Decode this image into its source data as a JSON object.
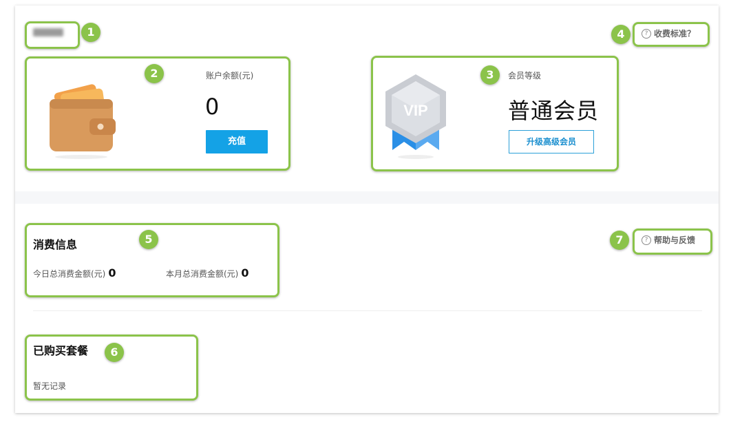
{
  "markers": [
    "1",
    "2",
    "3",
    "4",
    "5",
    "6",
    "7"
  ],
  "account": {
    "balance_label": "账户余额(元)",
    "balance_value": "0",
    "recharge_button": "充值"
  },
  "membership": {
    "label": "会员等级",
    "level": "普通会员",
    "badge_text": "VIP",
    "upgrade_button": "升级高级会员"
  },
  "links": {
    "pricing": "收费标准？",
    "help": "帮助与反馈"
  },
  "consumption": {
    "title": "消费信息",
    "today_label": "今日总消费金额(元)",
    "today_value": "0",
    "month_label": "本月总消费金额(元)",
    "month_value": "0"
  },
  "packages": {
    "title": "已购买套餐",
    "empty_text": "暂无记录"
  },
  "colors": {
    "accent_green": "#8bc34a",
    "primary_blue": "#14a2e6"
  }
}
